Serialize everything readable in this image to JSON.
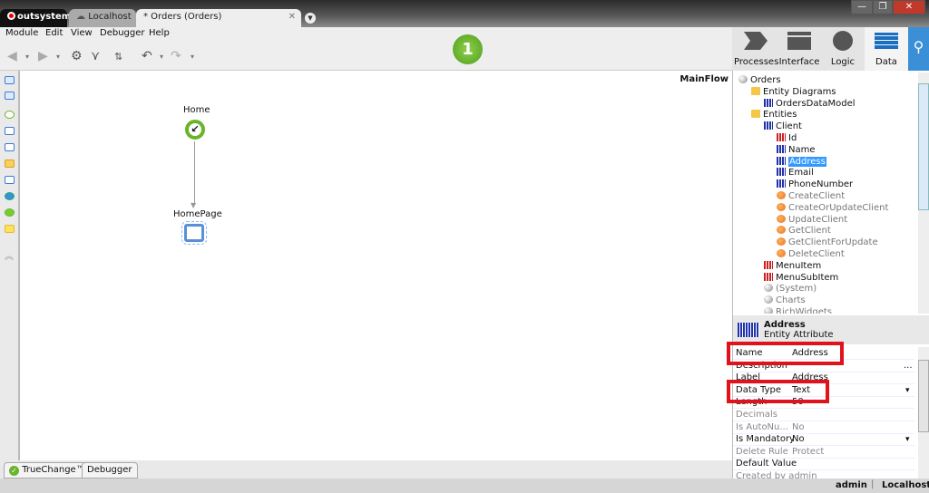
{
  "tabs": [
    {
      "label": "outsystems"
    },
    {
      "label": "Localhost"
    },
    {
      "label": "* Orders (Orders)"
    }
  ],
  "window_controls": {
    "minimize": "—",
    "restore": "❐",
    "close": "✕"
  },
  "menu": [
    "Module",
    "Edit",
    "View",
    "Debugger",
    "Help"
  ],
  "step_badge": "1",
  "nav": [
    {
      "label": "Processes"
    },
    {
      "label": "Interface"
    },
    {
      "label": "Logic"
    },
    {
      "label": "Data"
    }
  ],
  "canvas": {
    "flow_name": "MainFlow",
    "nodes": [
      {
        "label": "Home"
      },
      {
        "label": "HomePage"
      }
    ]
  },
  "tree": [
    {
      "label": "Orders",
      "icon": "globe",
      "indent": 0
    },
    {
      "label": "Entity Diagrams",
      "icon": "folder",
      "indent": 1
    },
    {
      "label": "OrdersDataModel",
      "icon": "diagram",
      "indent": 2
    },
    {
      "label": "Entities",
      "icon": "folder",
      "indent": 1
    },
    {
      "label": "Client",
      "icon": "entity",
      "indent": 2
    },
    {
      "label": "Id",
      "icon": "attribute-key",
      "indent": 3
    },
    {
      "label": "Name",
      "icon": "attribute",
      "indent": 3
    },
    {
      "label": "Address",
      "icon": "attribute",
      "indent": 3,
      "selected": true
    },
    {
      "label": "Email",
      "icon": "attribute",
      "indent": 3
    },
    {
      "label": "PhoneNumber",
      "icon": "attribute",
      "indent": 3
    },
    {
      "label": "CreateClient",
      "icon": "action",
      "indent": 3,
      "dim": true
    },
    {
      "label": "CreateOrUpdateClient",
      "icon": "action",
      "indent": 3,
      "dim": true
    },
    {
      "label": "UpdateClient",
      "icon": "action",
      "indent": 3,
      "dim": true
    },
    {
      "label": "GetClient",
      "icon": "action",
      "indent": 3,
      "dim": true
    },
    {
      "label": "GetClientForUpdate",
      "icon": "action",
      "indent": 3,
      "dim": true
    },
    {
      "label": "DeleteClient",
      "icon": "action",
      "indent": 3,
      "dim": true
    },
    {
      "label": "MenuItem",
      "icon": "entity-red",
      "indent": 2
    },
    {
      "label": "MenuSubItem",
      "icon": "entity-red",
      "indent": 2
    },
    {
      "label": "(System)",
      "icon": "globe",
      "indent": 2,
      "dim": true
    },
    {
      "label": "Charts",
      "icon": "globe",
      "indent": 2,
      "dim": true
    },
    {
      "label": "RichWidgets",
      "icon": "globe",
      "indent": 2,
      "dim": true
    }
  ],
  "props_header": {
    "title": "Address",
    "subtitle": "Entity Attribute"
  },
  "props": [
    {
      "key": "Name",
      "value": "Address"
    },
    {
      "key": "Description",
      "value": "..."
    },
    {
      "key": "Label",
      "value": "Address"
    },
    {
      "key": "Data Type",
      "value": "Text",
      "dropdown": true
    },
    {
      "key": "Length",
      "value": "50"
    },
    {
      "key": "Decimals",
      "value": "",
      "dim": true
    },
    {
      "key": "Is AutoNu...",
      "value": "No",
      "dim": true
    },
    {
      "key": "Is Mandatory",
      "value": "No",
      "dropdown": true
    },
    {
      "key": "Delete Rule",
      "value": "Protect",
      "dim": true
    },
    {
      "key": "Default Value",
      "value": ""
    },
    {
      "key": "Created by admin",
      "value": "",
      "dim": true
    }
  ],
  "bottom_tabs": [
    {
      "label": "TrueChange™"
    },
    {
      "label": "Debugger"
    }
  ],
  "status": {
    "user": "admin",
    "server": "Localhost"
  },
  "colors": {
    "highlight": "#e0121c",
    "accent": "#3a8fd6",
    "selected": "#3399ff"
  }
}
